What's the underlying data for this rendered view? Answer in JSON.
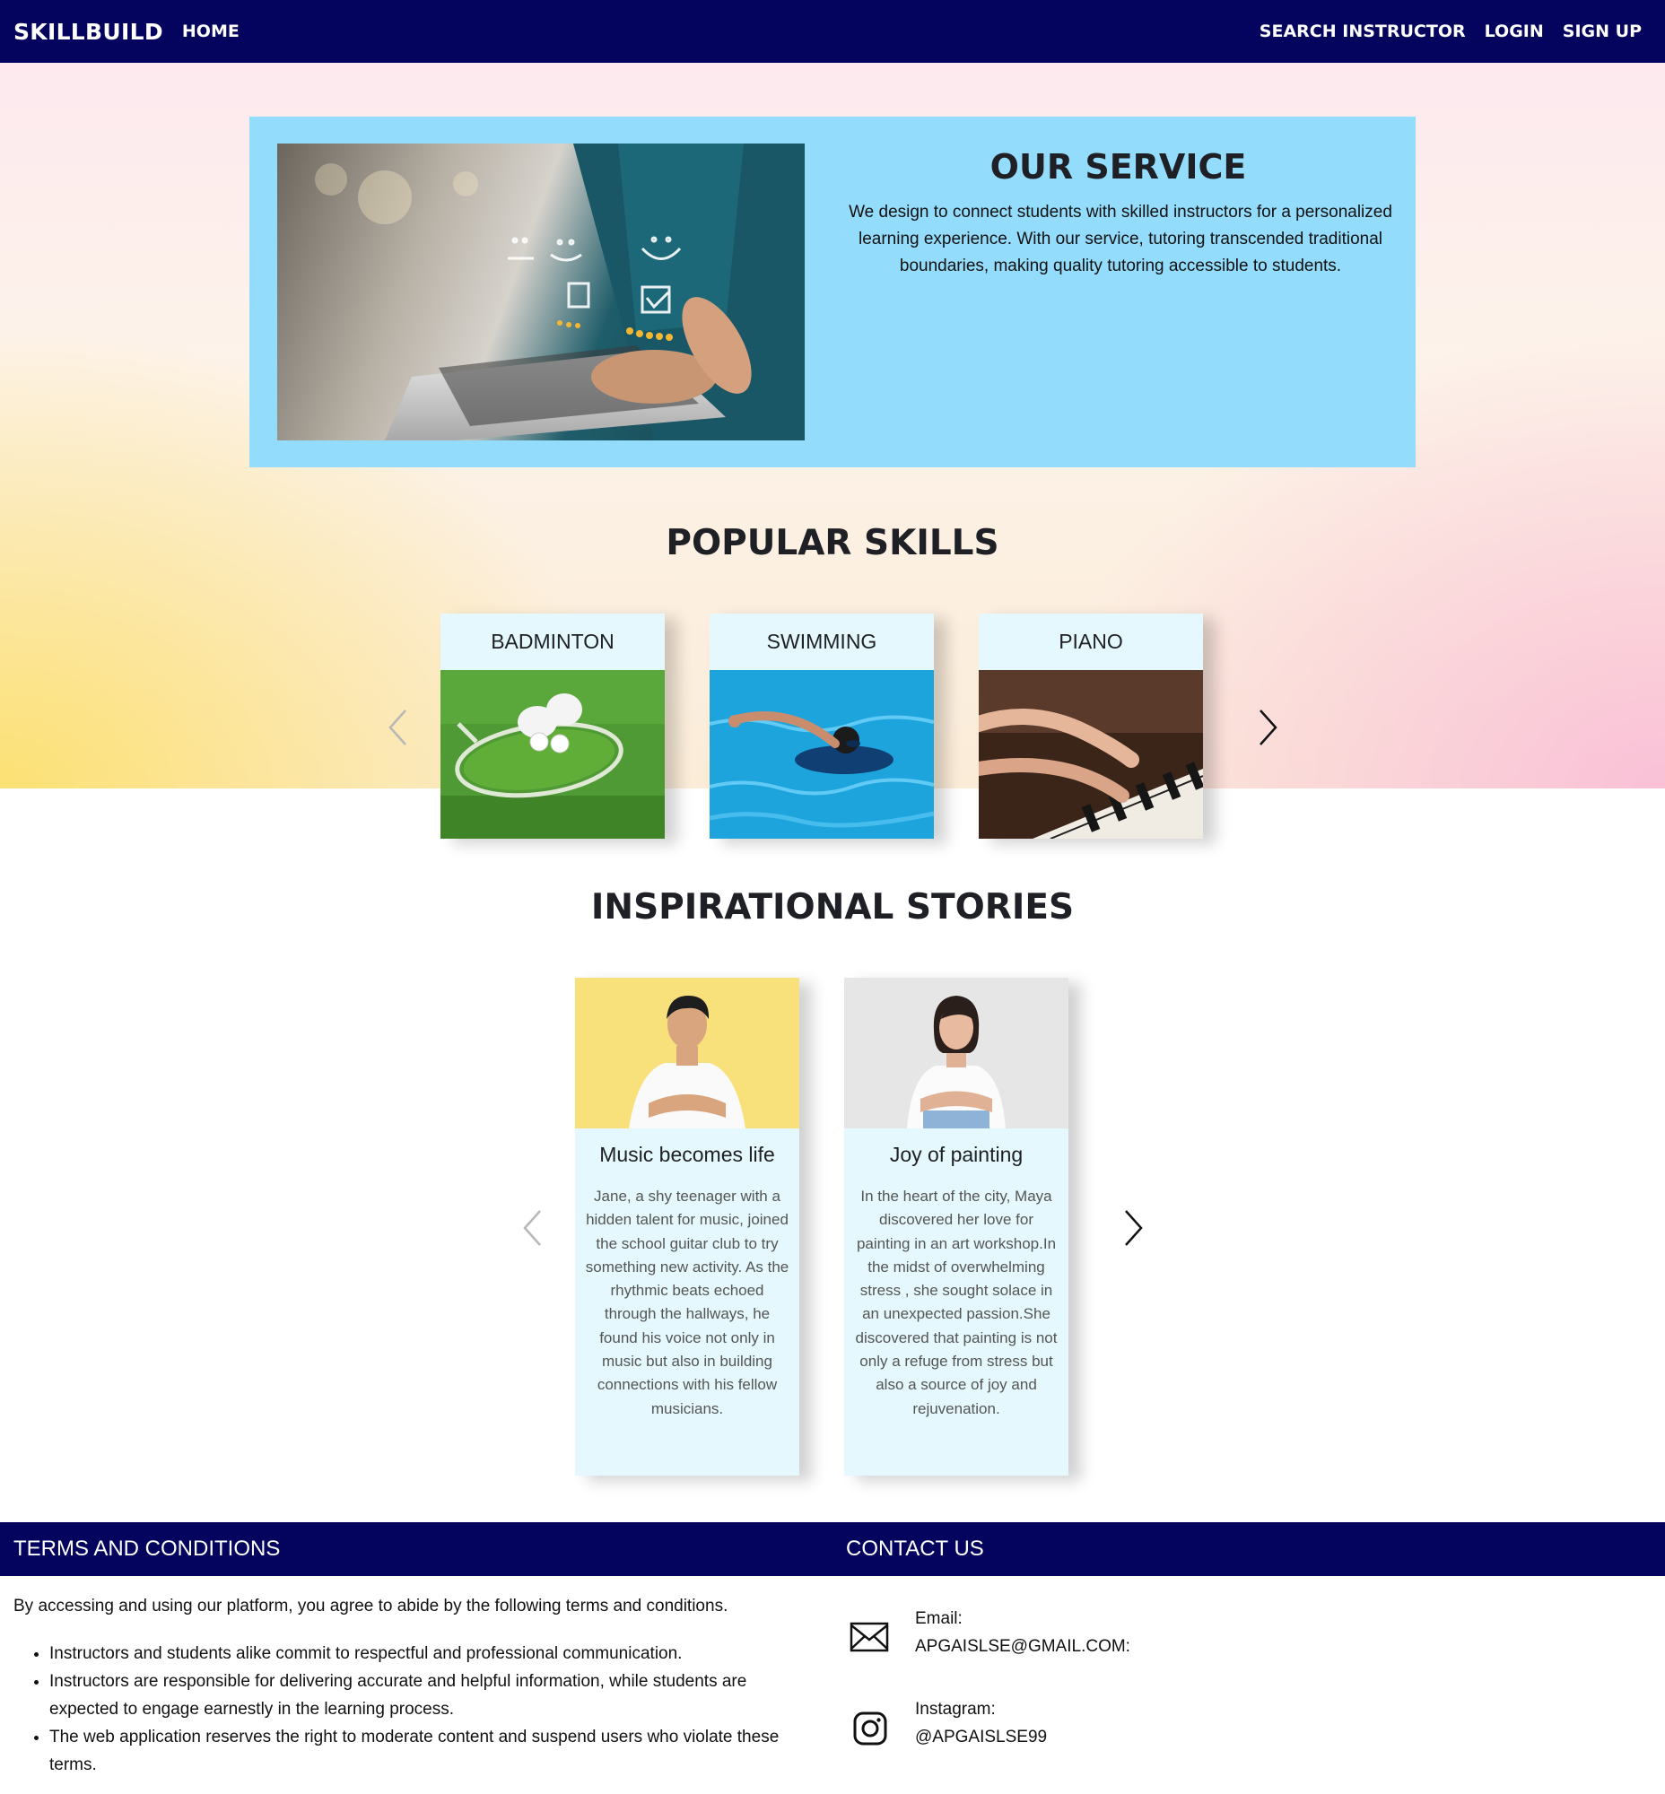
{
  "nav": {
    "brand": "SKILLBUILD",
    "home": "HOME",
    "search_instructor": "SEARCH INSTRUCTOR",
    "login": "LOGIN",
    "signup": "SIGN UP"
  },
  "service": {
    "title": "OUR SERVICE",
    "text": "We design to connect students with skilled instructors for a personalized learning experience. With our service, tutoring transcended traditional boundaries, making quality tutoring accessible to students."
  },
  "popular_skills": {
    "title": "POPULAR SKILLS",
    "items": [
      {
        "name": "BADMINTON"
      },
      {
        "name": "SWIMMING"
      },
      {
        "name": "PIANO"
      }
    ]
  },
  "stories": {
    "title": "INSPIRATIONAL STORIES",
    "items": [
      {
        "title": "Music becomes life",
        "text": "Jane, a shy teenager with a hidden talent for music, joined the school guitar club to try something new activity. As the rhythmic beats echoed through the hallways, he found his voice not only in music but also in building connections with his fellow musicians."
      },
      {
        "title": "Joy of painting",
        "text": "In the heart of the city, Maya discovered her love for painting in an art workshop.In the midst of overwhelming stress , she sought solace in an unexpected passion.She discovered that painting is not only a refuge from stress but also a source of joy and rejuvenation."
      }
    ]
  },
  "footer": {
    "terms_title": "TERMS AND CONDITIONS",
    "contact_title": "CONTACT US",
    "terms_intro": "By accessing and using our platform, you agree to abide by the following terms and conditions.",
    "terms_items": [
      "Instructors and students alike commit to respectful and professional communication.",
      "Instructors are responsible for delivering accurate and helpful information, while students are expected to engage earnestly in the learning process.",
      "The web application reserves the right to moderate content and suspend users who violate these terms."
    ],
    "email_label": "Email:",
    "email_value": "APGAISLSE@GMAIL.COM:",
    "instagram_label": "Instagram:",
    "instagram_value": "@APGAISLSE99"
  },
  "icons": {
    "prev": "chevron-left-icon",
    "next": "chevron-right-icon",
    "email": "envelope-icon",
    "instagram": "instagram-icon"
  },
  "colors": {
    "nav_bg": "#04045e",
    "service_bg": "#93dcfb",
    "card_bg": "#e4f8fd"
  }
}
